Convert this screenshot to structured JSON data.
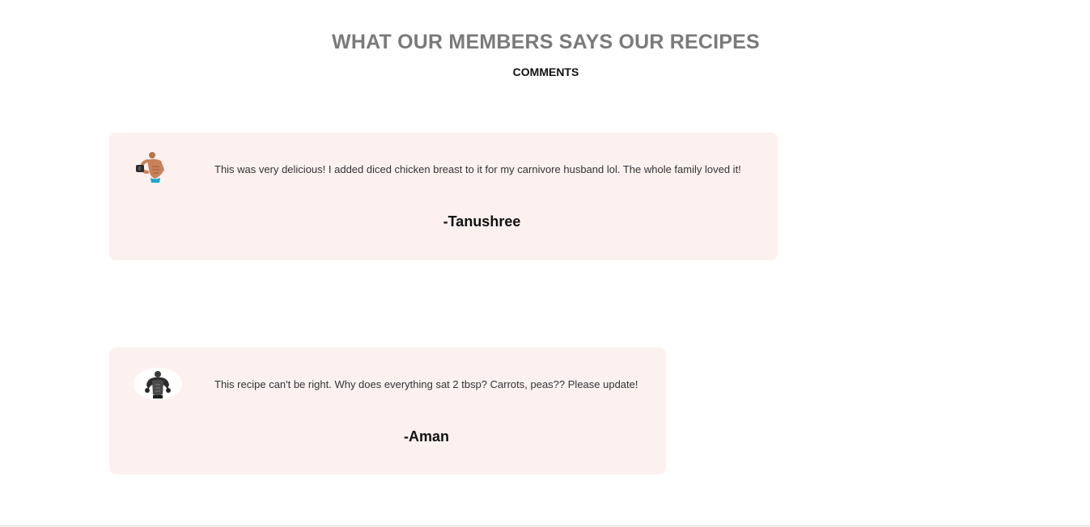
{
  "section": {
    "title": "WHAT OUR MEMBERS SAYS OUR RECIPES",
    "subtitle": "COMMENTS"
  },
  "comments": [
    {
      "avatar_icon": "bodybuilder-dumbbell-photo",
      "text": "This was very delicious! I added diced chicken breast to it for my carnivore husband lol. The whole family loved it!",
      "author": "-Tanushree"
    },
    {
      "avatar_icon": "bodybuilder-bw-photo",
      "text": "This recipe can't be right. Why does everything sat 2 tbsp? Carrots, peas?? Please update!",
      "author": "-Aman"
    }
  ],
  "colors": {
    "card_background": "#fdf1f0",
    "title_color": "#7a7a7a"
  }
}
